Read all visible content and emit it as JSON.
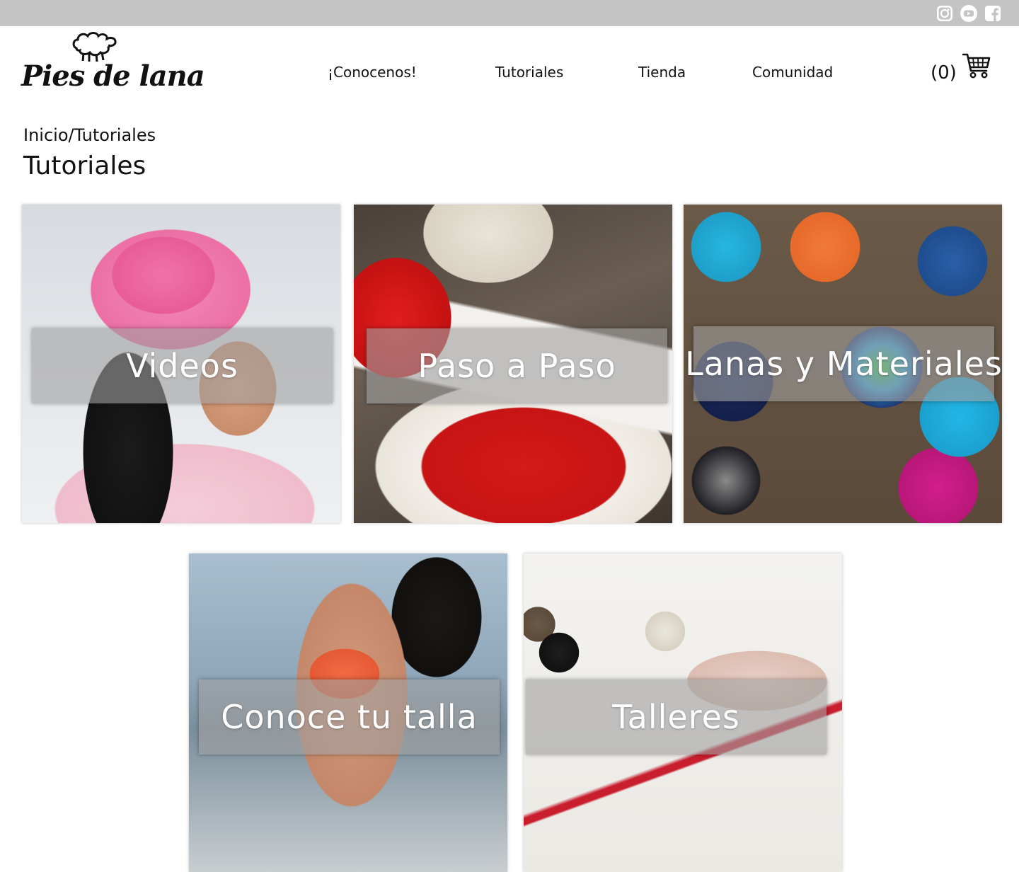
{
  "topbar": {
    "social": [
      {
        "icon": "instagram-icon"
      },
      {
        "icon": "youtube-icon"
      },
      {
        "icon": "facebook-icon"
      }
    ]
  },
  "brand": {
    "logo_text": "Pies de lana",
    "logo_icon": "sheep-icon"
  },
  "nav": {
    "items": [
      {
        "label": "¡Conocenos!"
      },
      {
        "label": "Tutoriales"
      },
      {
        "label": "Tienda"
      },
      {
        "label": "Comunidad"
      }
    ]
  },
  "cart": {
    "count": "(0)",
    "icon": "cart-icon"
  },
  "breadcrumb": "Inicio/Tutoriales",
  "page_title": "Tutoriales",
  "cards": [
    {
      "label": "Videos"
    },
    {
      "label": "Paso a Paso"
    },
    {
      "label": "Lanas y Materiales"
    },
    {
      "label": "Conoce tu talla"
    },
    {
      "label": "Talleres"
    }
  ],
  "colors": {
    "topbar": "#c4c4c4",
    "overlay": "#a0a0a0",
    "text": "#111111"
  }
}
